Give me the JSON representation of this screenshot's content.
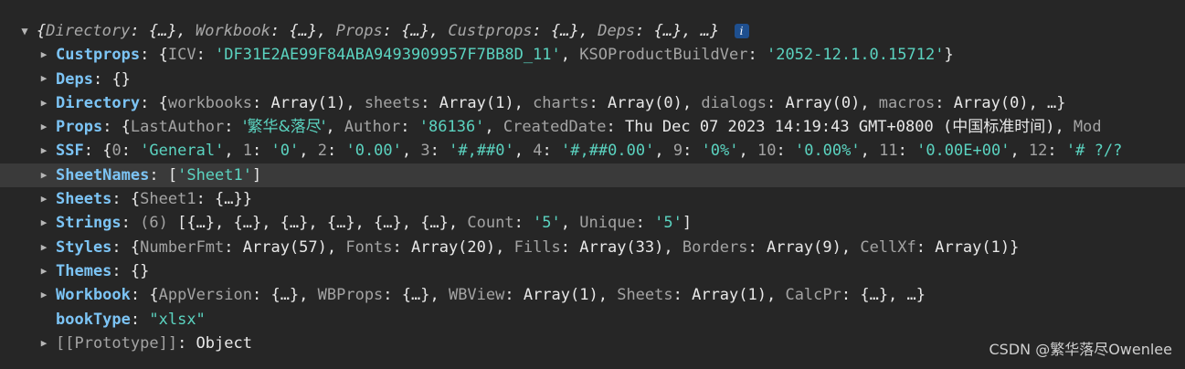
{
  "root": {
    "preview_text": "{Directory: {…}, Workbook: {…}, Props: {…}, Custprops: {…}, Deps: {…}, …}",
    "info_label": "i"
  },
  "rows": [
    {
      "key": "Custprops",
      "sep": ": ",
      "value": "{ICV: 'DF31E2AE99F84ABA9493909957F7BB8D_11', KSOProductBuildVer: '2052-12.1.0.15712'}"
    },
    {
      "key": "Deps",
      "sep": ": ",
      "value": "{}"
    },
    {
      "key": "Directory",
      "sep": ": ",
      "value": "{workbooks: Array(1), sheets: Array(1), charts: Array(0), dialogs: Array(0), macros: Array(0), …}"
    },
    {
      "key": "Props",
      "sep": ": ",
      "value": "{LastAuthor: '繁华&落尽', Author: '86136', CreatedDate: Thu Dec 07 2023 14:19:43 GMT+0800 (中国标准时间), Mod"
    },
    {
      "key": "SSF",
      "sep": ": ",
      "value": "{0: 'General', 1: '0', 2: '0.00', 3: '#,##0', 4: '#,##0.00', 9: '0%', 10: '0.00%', 11: '0.00E+00', 12: '# ?/?"
    },
    {
      "key": "SheetNames",
      "sep": ": ",
      "value": "['Sheet1']"
    },
    {
      "key": "Sheets",
      "sep": ": ",
      "value": "{Sheet1: {…}}"
    },
    {
      "key": "Strings",
      "sep": ": ",
      "value": "(6) [{…}, {…}, {…}, {…}, {…}, {…}, Count: '5', Unique: '5']"
    },
    {
      "key": "Styles",
      "sep": ": ",
      "value": "{NumberFmt: Array(57), Fonts: Array(20), Fills: Array(33), Borders: Array(9), CellXf: Array(1)}"
    },
    {
      "key": "Themes",
      "sep": ": ",
      "value": "{}"
    },
    {
      "key": "Workbook",
      "sep": ": ",
      "value": "{AppVersion: {…}, WBProps: {…}, WBView: Array(1), Sheets: Array(1), CalcPr: {…}, …}"
    },
    {
      "key": "bookType",
      "sep": ": ",
      "value": "\"xlsx\""
    },
    {
      "key": "[[Prototype]]",
      "sep": ": ",
      "value": "Object"
    }
  ],
  "watermark": "CSDN @繁华落尽Owenlee"
}
